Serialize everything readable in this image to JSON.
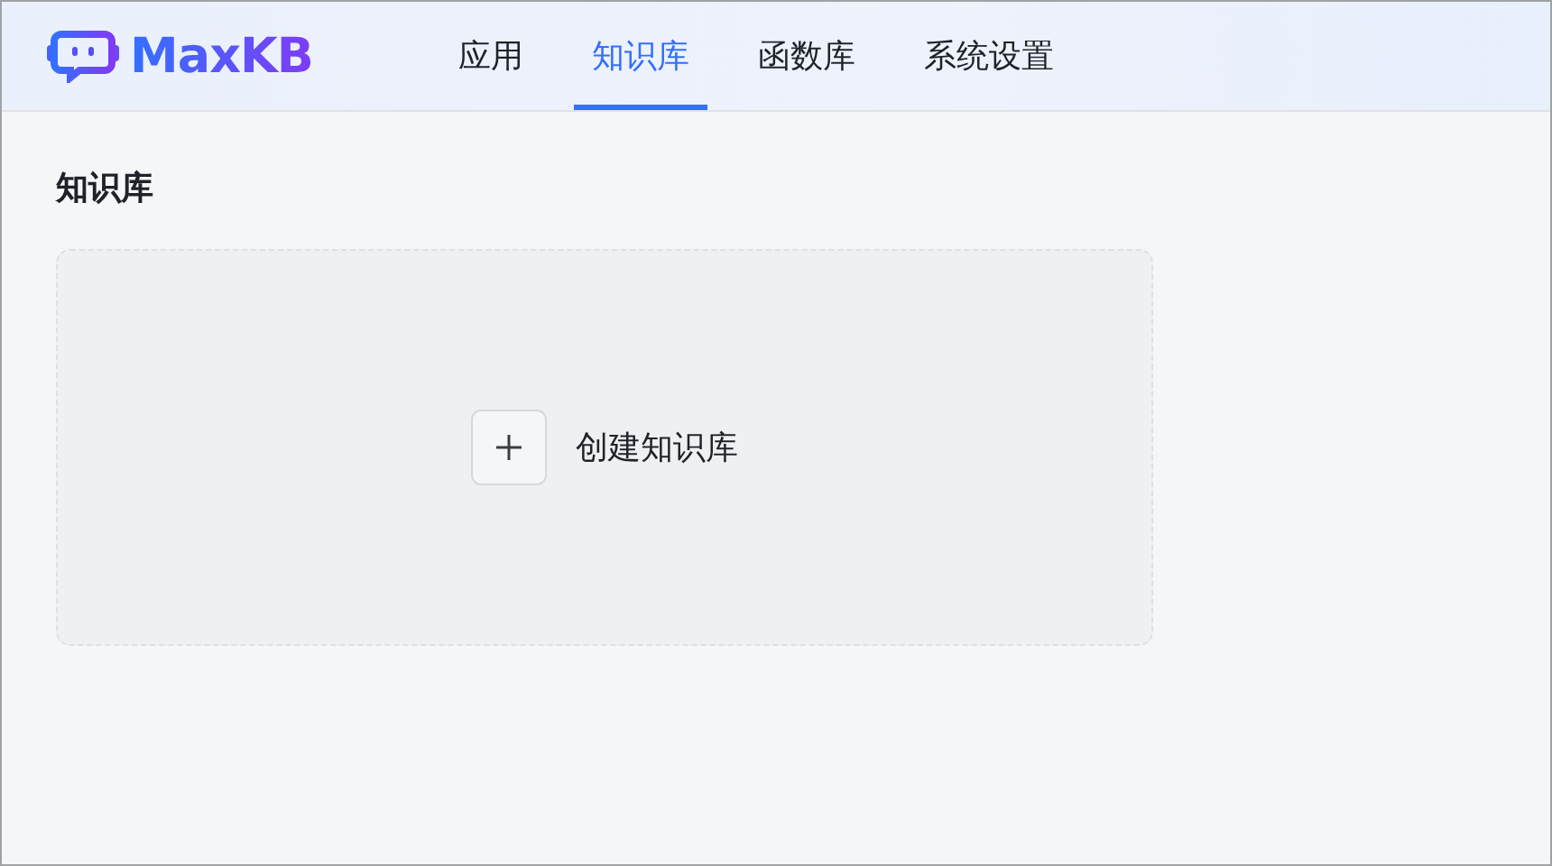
{
  "header": {
    "logo_text": "MaxKB",
    "nav": [
      {
        "label": "应用",
        "selected": false
      },
      {
        "label": "知识库",
        "selected": true
      },
      {
        "label": "函数库",
        "selected": false
      },
      {
        "label": "系统设置",
        "selected": false
      }
    ]
  },
  "page": {
    "title": "知识库",
    "create_card": {
      "label": "创建知识库"
    }
  }
}
